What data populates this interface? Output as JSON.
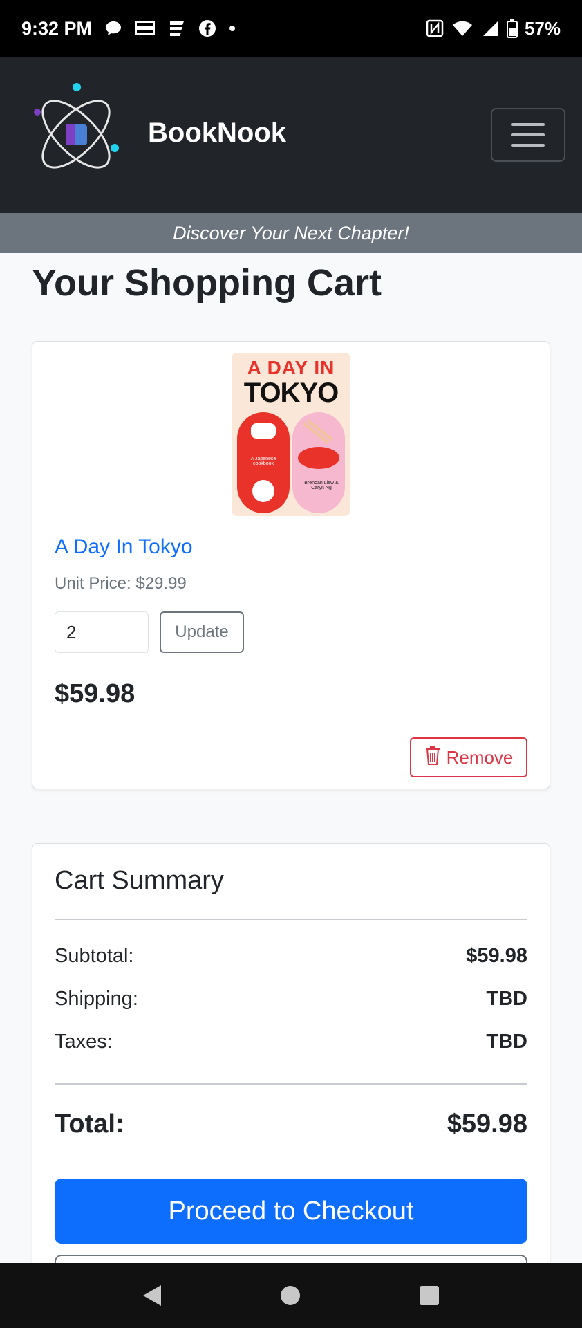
{
  "status_bar": {
    "time": "9:32 PM",
    "battery": "57%",
    "left_icons": [
      "chat-bubble-icon",
      "temu-icon",
      "news-icon",
      "facebook-icon",
      "dot-icon"
    ],
    "right_icons": [
      "nfc-icon",
      "wifi-icon",
      "signal-icon",
      "battery-icon"
    ]
  },
  "navbar": {
    "brand_name": "BookNook",
    "menu_icon": "hamburger-menu-icon"
  },
  "tagline": "Discover Your Next Chapter!",
  "page_title": "Your Shopping Cart",
  "cart_item": {
    "cover": {
      "title_line1": "A DAY IN",
      "title_line2": "TOKYO",
      "subtitle": "A Japanese cookbook",
      "authors": "Brendan Liew & Caryn Ng"
    },
    "title": "A Day In Tokyo",
    "unit_price": "Unit Price: $29.99",
    "quantity": "2",
    "update_label": "Update",
    "line_total": "$59.98",
    "remove_label": "Remove"
  },
  "summary": {
    "title": "Cart Summary",
    "subtotal_label": "Subtotal:",
    "subtotal_value": "$59.98",
    "shipping_label": "Shipping:",
    "shipping_value": "TBD",
    "taxes_label": "Taxes:",
    "taxes_value": "TBD",
    "total_label": "Total:",
    "total_value": "$59.98",
    "checkout_label": "Proceed to Checkout"
  },
  "colors": {
    "primary": "#0d6efd",
    "danger": "#dc3545",
    "navbar_bg": "#212529",
    "tagline_bg": "#6c757d"
  }
}
